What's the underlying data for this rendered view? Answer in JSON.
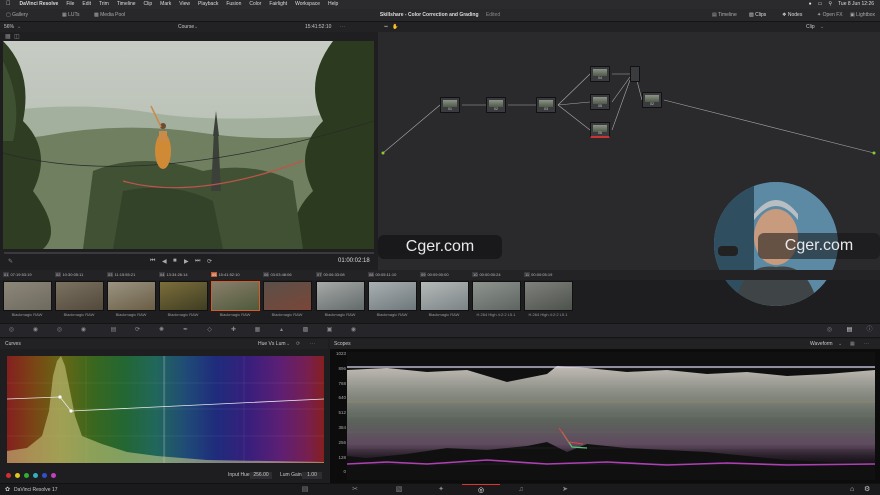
{
  "menubar": {
    "app_name": "DaVinci Resolve",
    "items": [
      "File",
      "Edit",
      "Trim",
      "Timeline",
      "Clip",
      "Mark",
      "View",
      "Playback",
      "Fusion",
      "Color",
      "Fairlight",
      "Workspace",
      "Help"
    ],
    "clock": "Tue 8 Jun  12:26"
  },
  "toolbar": {
    "gallery": "Gallery",
    "luts": "LUTs",
    "media_pool": "Media Pool",
    "project_title": "Skillshare - Color Correction and Grading",
    "edited": "Edited",
    "timeline": "Timeline",
    "clips": "Clips",
    "nodes": "Nodes",
    "open_fx": "Open FX",
    "lightbox": "Lightbox"
  },
  "viewer": {
    "zoom": "56%",
    "timeline_name": "Course",
    "timecode": "15:41:52:10",
    "dots": "···",
    "playhead_timecode": "01:00:02:18"
  },
  "node_editor": {
    "mode": "Clip",
    "nodes": [
      "01",
      "02",
      "03",
      "04",
      "05",
      "06",
      "06",
      "02"
    ]
  },
  "watermark": {
    "left": "Cger.com",
    "right": "Cger.com"
  },
  "clips": [
    {
      "num": "01",
      "tc": "07:19:53:19",
      "label": "Blackmagic RAW"
    },
    {
      "num": "02",
      "tc": "10:30:05:11",
      "label": "Blackmagic RAW"
    },
    {
      "num": "03",
      "tc": "11:15:55:21",
      "label": "Blackmagic RAW"
    },
    {
      "num": "04",
      "tc": "13:34:26:14",
      "label": "Blackmagic RAW"
    },
    {
      "num": "05",
      "tc": "15:41:52:10",
      "label": "Blackmagic RAW"
    },
    {
      "num": "06",
      "tc": "03:03:48:06",
      "label": "Blackmagic RAW"
    },
    {
      "num": "07",
      "tc": "00:06:33:08",
      "label": "Blackmagic RAW"
    },
    {
      "num": "08",
      "tc": "00:05:11:10",
      "label": "Blackmagic RAW"
    },
    {
      "num": "09",
      "tc": "00:09:00:00",
      "label": "Blackmagic RAW"
    },
    {
      "num": "10",
      "tc": "00:00:00:24",
      "label": "H.264 High 4:2:2 L5.1"
    },
    {
      "num": "11",
      "tc": "00:00:05:19",
      "label": "H.264 High 4:2:2 L5.1"
    }
  ],
  "curves": {
    "title": "Curves",
    "mode": "Hue Vs Lum",
    "input_hue_label": "Input Hue",
    "input_hue_value": "256.00",
    "lum_gain_label": "Lum Gain",
    "lum_gain_value": "1.00",
    "swatches": [
      "#d23030",
      "#d8c820",
      "#30b030",
      "#30b0c0",
      "#3050d0",
      "#c040c0"
    ]
  },
  "scopes": {
    "title": "Scopes",
    "mode": "Waveform",
    "ticks": [
      "1023",
      "896",
      "768",
      "640",
      "512",
      "384",
      "256",
      "128",
      "0"
    ]
  },
  "bottom": {
    "app_version": "DaVinci Resolve 17"
  },
  "colors": {
    "accent": "#d35c2a",
    "active_page": "#d33333"
  }
}
